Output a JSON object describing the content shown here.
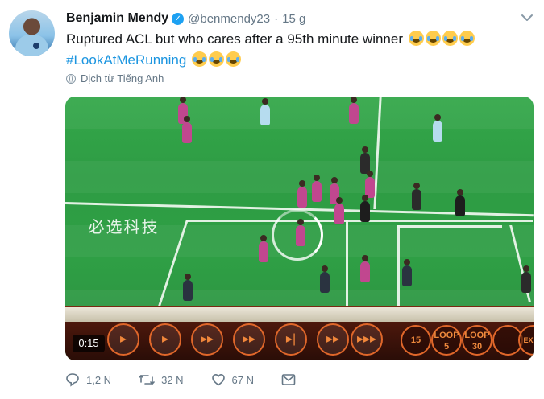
{
  "tweet": {
    "author_name": "Benjamin Mendy",
    "handle": "@benmendy23",
    "separator": "·",
    "time": "15 g",
    "text_line1": "Ruptured ACL but who cares after a 95th minute winner",
    "hashtag": "#LookAtMeRunning",
    "translate_label": "Dịch từ Tiếng Anh"
  },
  "media": {
    "duration": "0:15",
    "sponsor_text": "必选科技",
    "ad_icons": [
      "15",
      "LOOP 5",
      "LOOP 30",
      "",
      "EXPO"
    ]
  },
  "actions": {
    "reply_count": "1,2 N",
    "retweet_count": "32 N",
    "like_count": "67 N"
  },
  "icons": {
    "verified": "verified-badge-icon",
    "more": "chevron-down-icon",
    "globe": "globe-icon",
    "reply": "reply-icon",
    "retweet": "retweet-icon",
    "like": "heart-icon",
    "dm": "envelope-icon"
  },
  "colors": {
    "text": "#14171a",
    "muted": "#657786",
    "link": "#1b95e0",
    "verified": "#1da1f2"
  }
}
